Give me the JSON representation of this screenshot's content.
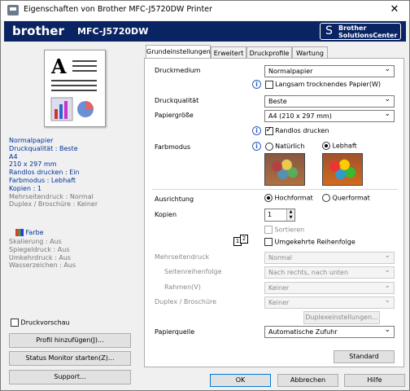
{
  "title": "Eigenschaften von Brother MFC-J5720DW Printer",
  "banner": {
    "brand": "brother",
    "model": "MFC-J5720DW",
    "solutions_line1": "Brother",
    "solutions_line2": "SolutionsCenter"
  },
  "summary": {
    "blue": [
      "Normalpapier",
      "Druckqualität : Beste",
      "A4",
      "210 x 297 mm",
      "Randlos drucken : Ein",
      "Farbmodus : Lebhaft",
      "Kopien : 1"
    ],
    "gray": [
      "Mehrseitendruck : Normal",
      "Duplex / Broschüre : Keiner"
    ],
    "farbe": "Farbe",
    "gray2": [
      "Skalierung : Aus",
      "Spiegeldruck : Aus",
      "Umkehrdruck : Aus",
      "Wasserzeichen : Aus"
    ]
  },
  "left": {
    "preview_label": "Druckvorschau",
    "profil_btn": "Profil hinzufügen(J)...",
    "status_btn": "Status Monitor starten(Z)...",
    "support_btn": "Support..."
  },
  "tabs": [
    "Grundeinstellungen",
    "Erweitert",
    "Druckprofile",
    "Wartung"
  ],
  "panel": {
    "druckmedium_label": "Druckmedium",
    "druckmedium_value": "Normalpapier",
    "slow_dry_label": "Langsam trocknendes Papier(W)",
    "quality_label": "Druckqualität",
    "quality_value": "Beste",
    "size_label": "Papiergröße",
    "size_value": "A4 (210 x 297 mm)",
    "borderless_label": "Randlos drucken",
    "color_label": "Farbmodus",
    "color_natural": "Natürlich",
    "color_vivid": "Lebhaft",
    "orientation_label": "Ausrichtung",
    "portrait": "Hochformat",
    "landscape": "Querformat",
    "copies_label": "Kopien",
    "copies_value": "1",
    "sort_label": "Sortieren",
    "reverse_label": "Umgekehrte Reihenfolge",
    "multipage_label": "Mehrseitendruck",
    "multipage_value": "Normal",
    "page_order_label": "Seitenreihenfolge",
    "page_order_value": "Nach rechts, nach unten",
    "border_label": "Rahmen(V)",
    "border_value": "Keiner",
    "duplex_label": "Duplex / Broschüre",
    "duplex_value": "Keiner",
    "duplex_settings_btn": "Duplexeinstellungen...",
    "source_label": "Papierquelle",
    "source_value": "Automatische Zufuhr",
    "standard_btn": "Standard",
    "pages_icon_1": "1",
    "pages_icon_2": "2"
  },
  "buttons": {
    "ok": "OK",
    "cancel": "Abbrechen",
    "help": "Hilfe"
  }
}
